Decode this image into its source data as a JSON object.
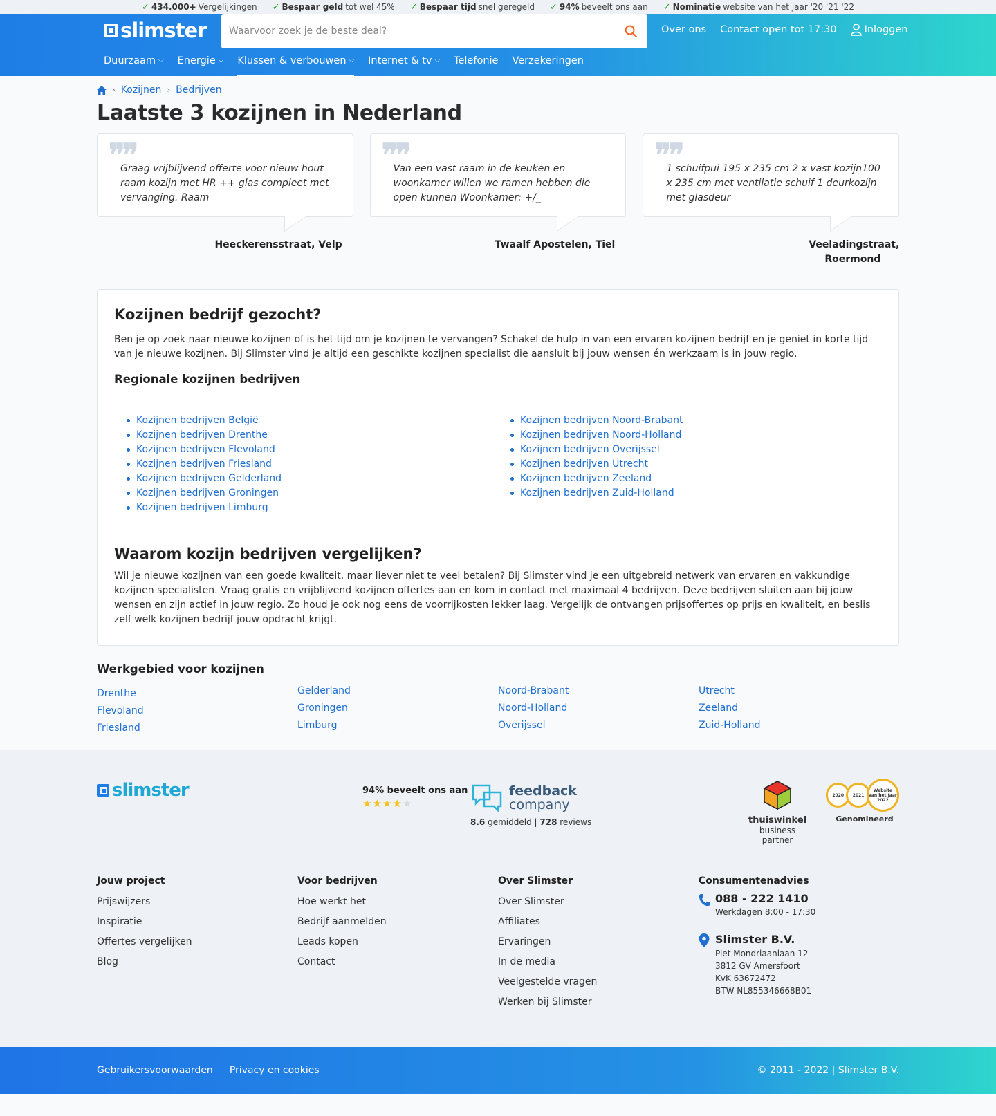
{
  "usp": [
    {
      "bold": "434.000+",
      "text": "Vergelijkingen"
    },
    {
      "bold": "Bespaar geld",
      "text": "tot wel 45%"
    },
    {
      "bold": "Bespaar tijd",
      "text": "snel geregeld"
    },
    {
      "bold": "94%",
      "text": "beveelt ons aan"
    },
    {
      "bold": "Nominatie",
      "text": "website van het jaar '20 '21 '22"
    }
  ],
  "header": {
    "logo": "slimster",
    "search_placeholder": "Waarvoor zoek je de beste deal?",
    "about": "Over ons",
    "contact": "Contact open tot 17:30",
    "login": "Inloggen"
  },
  "nav": [
    {
      "label": "Duurzaam",
      "dropdown": true
    },
    {
      "label": "Energie",
      "dropdown": true
    },
    {
      "label": "Klussen & verbouwen",
      "dropdown": true,
      "active": true
    },
    {
      "label": "Internet & tv",
      "dropdown": true
    },
    {
      "label": "Telefonie",
      "dropdown": false
    },
    {
      "label": "Verzekeringen",
      "dropdown": false
    }
  ],
  "breadcrumb": [
    "Kozijnen",
    "Bedrijven"
  ],
  "page_title": "Laatste 3 kozijnen in Nederland",
  "reviews": [
    {
      "text": "Graag vrijblijvend offerte voor nieuw hout raam kozijn met HR ++ glas compleet met vervanging. Raam",
      "location": "Heeckerensstraat, Velp"
    },
    {
      "text": "Van een vast raam in de keuken en woonkamer willen we ramen hebben die open kunnen Woonkamer: +/_",
      "location": "Twaalf Apostelen, Tiel"
    },
    {
      "text": "1 schuifpui 195 x 235 cm 2 x vast kozijn100 x 235 cm met ventilatie schuif 1 deurkozijn met glasdeur",
      "location": "Veeladingstraat, Roermond"
    }
  ],
  "intro": {
    "title": "Kozijnen bedrijf gezocht?",
    "text": "Ben je op zoek naar nieuwe kozijnen of is het tijd om je kozijnen te vervangen? Schakel de hulp in van een ervaren kozijnen bedrijf en je geniet in korte tijd van je nieuwe kozijnen. Bij Slimster vind je altijd een geschikte kozijnen specialist die aansluit bij jouw wensen én werkzaam is in jouw regio.",
    "regional_title": "Regionale kozijnen bedrijven",
    "regional_left": [
      "Kozijnen bedrijven België",
      "Kozijnen bedrijven Drenthe",
      "Kozijnen bedrijven Flevoland",
      "Kozijnen bedrijven Friesland",
      "Kozijnen bedrijven Gelderland",
      "Kozijnen bedrijven Groningen",
      "Kozijnen bedrijven Limburg"
    ],
    "regional_right": [
      "Kozijnen bedrijven Noord-Brabant",
      "Kozijnen bedrijven Noord-Holland",
      "Kozijnen bedrijven Overijssel",
      "Kozijnen bedrijven Utrecht",
      "Kozijnen bedrijven Zeeland",
      "Kozijnen bedrijven Zuid-Holland"
    ]
  },
  "why": {
    "title": "Waarom kozijn bedrijven vergelijken?",
    "text": "Wil je nieuwe kozijnen van een goede kwaliteit, maar liever niet te veel betalen? Bij Slimster vind je een uitgebreid netwerk van ervaren en vakkundige kozijnen specialisten. Vraag gratis en vrijblijvend kozijnen offertes aan en kom in contact met maximaal 4 bedrijven. Deze bedrijven sluiten aan bij jouw wensen en zijn actief in jouw regio. Zo houd je ook nog eens de voorrijkosten lekker laag. Vergelijk de ontvangen prijsoffertes op prijs en kwaliteit, en beslis zelf welk kozijnen bedrijf jouw opdracht krijgt."
  },
  "work_area": {
    "title": "Werkgebied voor kozijnen",
    "cols": [
      [
        "Drenthe",
        "Flevoland",
        "Friesland"
      ],
      [
        "Gelderland",
        "Groningen",
        "Limburg"
      ],
      [
        "Noord-Brabant",
        "Noord-Holland",
        "Overijssel"
      ],
      [
        "Utrecht",
        "Zeeland",
        "Zuid-Holland"
      ]
    ]
  },
  "footer": {
    "logo": "slimster",
    "rating_title": "94% beveelt ons aan",
    "rating_stars": 4.5,
    "feedback_name_1": "feedback",
    "feedback_name_2": "company",
    "feedback_avg": "8.6",
    "feedback_avg_label": "gemiddeld |",
    "feedback_reviews": "728",
    "feedback_reviews_label": "reviews",
    "tw_name": "thuiswinkel",
    "tw_sub": "business partner",
    "medals": [
      "2020",
      "2021",
      "Website van het Jaar 2022"
    ],
    "award_label": "Genomineerd",
    "col1": {
      "title": "Jouw project",
      "links": [
        "Prijswijzers",
        "Inspiratie",
        "Offertes vergelijken",
        "Blog"
      ]
    },
    "col2": {
      "title": "Voor bedrijven",
      "links": [
        "Hoe werkt het",
        "Bedrijf aanmelden",
        "Leads kopen",
        "Contact"
      ]
    },
    "col3": {
      "title": "Over Slimster",
      "links": [
        "Over Slimster",
        "Affiliates",
        "Ervaringen",
        "In de media",
        "Veelgestelde vragen",
        "Werken bij Slimster"
      ]
    },
    "col4": {
      "title": "Consumentenadvies",
      "phone": "088 - 222 1410",
      "hours": "Werkdagen 8:00 - 17:30",
      "company": "Slimster B.V.",
      "address1": "Piet Mondriaanlaan 12",
      "address2": "3812 GV Amersfoort",
      "kvk": "KvK 63672472",
      "btw": "BTW NL855346668B01"
    },
    "bottom_links": [
      "Gebruikersvoorwaarden",
      "Privacy en cookies"
    ],
    "copyright": "© 2011 - 2022 | Slimster B.V."
  },
  "colors": {
    "brand_blue": "#1f7ee6",
    "teal": "#2ed6cc",
    "link": "#1f6fd1",
    "star": "#f3c21b",
    "search_icon": "#f26522"
  }
}
